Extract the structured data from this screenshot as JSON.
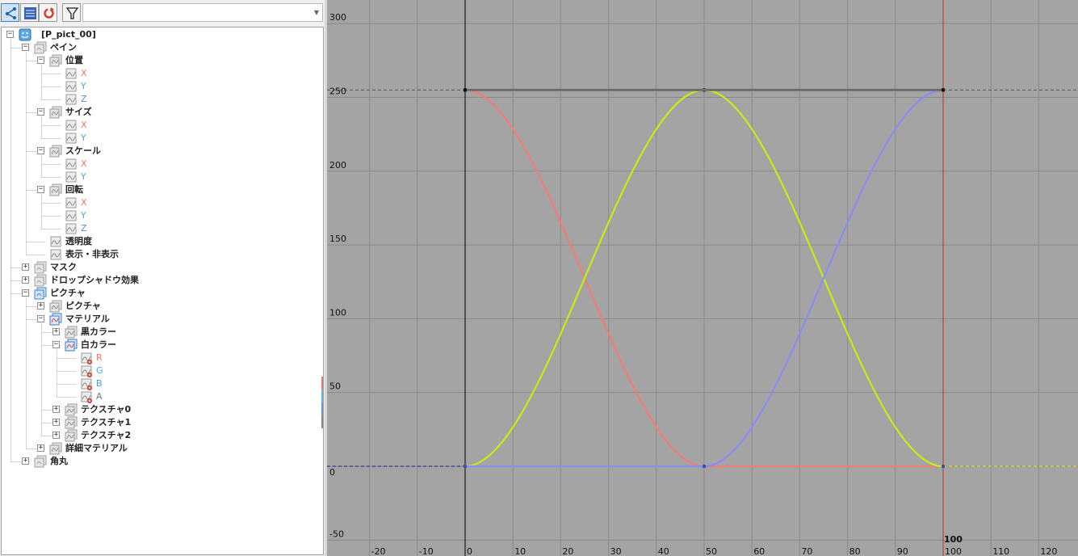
{
  "toolbar": {
    "buttons": [
      {
        "name": "tree-view-button",
        "icon": "tree-icon",
        "active": true
      },
      {
        "name": "list-view-button",
        "icon": "list-icon",
        "active": false
      },
      {
        "name": "refresh-button",
        "icon": "refresh-icon",
        "active": false
      },
      {
        "name": "filter-button",
        "icon": "filter-icon",
        "active": false
      }
    ],
    "filter_value": ""
  },
  "tree": [
    {
      "label": "[P_pict_00]",
      "depth": 0,
      "expander": "-",
      "icon": "layer-face-icon",
      "name": "tree-node-root"
    },
    {
      "label": "ペイン",
      "depth": 1,
      "expander": "-",
      "icon": "group-icon",
      "name": "tree-node-pane"
    },
    {
      "label": "位置",
      "depth": 2,
      "expander": "-",
      "icon": "curve-group-icon",
      "name": "tree-node-position"
    },
    {
      "label": "X",
      "depth": 3,
      "icon": "curve-icon",
      "style": "axis-x",
      "name": "tree-node-position-x"
    },
    {
      "label": "Y",
      "depth": 3,
      "icon": "curve-icon",
      "style": "axis-y",
      "name": "tree-node-position-y"
    },
    {
      "label": "Z",
      "depth": 3,
      "icon": "curve-icon",
      "style": "axis-z",
      "name": "tree-node-position-z"
    },
    {
      "label": "サイズ",
      "depth": 2,
      "expander": "-",
      "icon": "curve-group-icon",
      "name": "tree-node-size"
    },
    {
      "label": "X",
      "depth": 3,
      "icon": "curve-icon",
      "style": "axis-x",
      "name": "tree-node-size-x"
    },
    {
      "label": "Y",
      "depth": 3,
      "icon": "curve-icon",
      "style": "axis-y",
      "name": "tree-node-size-y"
    },
    {
      "label": "スケール",
      "depth": 2,
      "expander": "-",
      "icon": "curve-group-icon",
      "name": "tree-node-scale"
    },
    {
      "label": "X",
      "depth": 3,
      "icon": "curve-icon",
      "style": "axis-x",
      "name": "tree-node-scale-x"
    },
    {
      "label": "Y",
      "depth": 3,
      "icon": "curve-icon",
      "style": "axis-y",
      "name": "tree-node-scale-y"
    },
    {
      "label": "回転",
      "depth": 2,
      "expander": "-",
      "icon": "curve-group-icon",
      "name": "tree-node-rotation"
    },
    {
      "label": "X",
      "depth": 3,
      "icon": "curve-icon",
      "style": "axis-x",
      "name": "tree-node-rotation-x"
    },
    {
      "label": "Y",
      "depth": 3,
      "icon": "curve-icon",
      "style": "axis-y",
      "name": "tree-node-rotation-y"
    },
    {
      "label": "Z",
      "depth": 3,
      "icon": "curve-icon",
      "style": "axis-z",
      "name": "tree-node-rotation-z"
    },
    {
      "label": "透明度",
      "depth": 2,
      "icon": "curve-icon",
      "name": "tree-node-opacity"
    },
    {
      "label": "表示・非表示",
      "depth": 2,
      "icon": "curve-icon",
      "name": "tree-node-visibility"
    },
    {
      "label": "マスク",
      "depth": 1,
      "expander": "+",
      "icon": "group-icon",
      "name": "tree-node-mask"
    },
    {
      "label": "ドロップシャドウ効果",
      "depth": 1,
      "expander": "+",
      "icon": "group-icon",
      "name": "tree-node-drop-shadow"
    },
    {
      "label": "ピクチャ",
      "depth": 1,
      "expander": "-",
      "icon": "picture-group-icon",
      "name": "tree-node-picture"
    },
    {
      "label": "ピクチャ",
      "depth": 2,
      "expander": "+",
      "icon": "curve-group-icon",
      "name": "tree-node-picture-sub"
    },
    {
      "label": "マテリアル",
      "depth": 2,
      "expander": "-",
      "icon": "curve-group-blue-icon",
      "name": "tree-node-material"
    },
    {
      "label": "黒カラー",
      "depth": 3,
      "expander": "+",
      "icon": "curve-group-icon",
      "name": "tree-node-black-color"
    },
    {
      "label": "白カラー",
      "depth": 3,
      "expander": "-",
      "icon": "curve-group-blue-icon",
      "name": "tree-node-white-color"
    },
    {
      "label": "R",
      "depth": 4,
      "icon": "curve-key-icon",
      "style": "ch-r",
      "name": "tree-node-white-r"
    },
    {
      "label": "G",
      "depth": 4,
      "icon": "curve-key-icon",
      "style": "ch-g",
      "name": "tree-node-white-g"
    },
    {
      "label": "B",
      "depth": 4,
      "icon": "curve-key-icon",
      "style": "ch-b",
      "name": "tree-node-white-b"
    },
    {
      "label": "A",
      "depth": 4,
      "icon": "curve-key-icon",
      "style": "ch-a",
      "name": "tree-node-white-a"
    },
    {
      "label": "テクスチャ0",
      "depth": 3,
      "expander": "+",
      "icon": "curve-group-icon",
      "name": "tree-node-texture0"
    },
    {
      "label": "テクスチャ1",
      "depth": 3,
      "expander": "+",
      "icon": "curve-group-icon",
      "name": "tree-node-texture1"
    },
    {
      "label": "テクスチャ2",
      "depth": 3,
      "expander": "+",
      "icon": "curve-group-icon",
      "name": "tree-node-texture2"
    },
    {
      "label": "詳細マテリアル",
      "depth": 2,
      "expander": "+",
      "icon": "curve-group-icon",
      "name": "tree-node-detail-material"
    },
    {
      "label": "角丸",
      "depth": 1,
      "expander": "+",
      "icon": "group-icon",
      "name": "tree-node-rounded-corner"
    }
  ],
  "graph": {
    "x_ticks": [
      -20,
      -10,
      0,
      10,
      20,
      30,
      40,
      50,
      60,
      70,
      80,
      90,
      100,
      110,
      120
    ],
    "y_ticks": [
      -50,
      0,
      50,
      100,
      150,
      200,
      250,
      300
    ],
    "current_frame": 100,
    "current_frame_label": "100",
    "max_value_line": 255,
    "background": "#a4a4a4",
    "grid_color": "#8a8a8a",
    "frame_line_color": "#cc2a2a"
  },
  "chart_data": {
    "type": "line",
    "x_range": [
      -25,
      127
    ],
    "y_range": [
      -55,
      310
    ],
    "series": [
      {
        "name": "R",
        "color": "#f07d76",
        "keys": [
          [
            0,
            255
          ],
          [
            50,
            0
          ],
          [
            100,
            0
          ]
        ]
      },
      {
        "name": "G",
        "color": "#c6ee10",
        "keys": [
          [
            0,
            0
          ],
          [
            50,
            255
          ],
          [
            100,
            0
          ]
        ]
      },
      {
        "name": "B",
        "color": "#8a8cf5",
        "keys": [
          [
            0,
            0
          ],
          [
            50,
            0
          ],
          [
            100,
            255
          ]
        ]
      },
      {
        "name": "A",
        "color": "#6e6e6e",
        "keys": [
          [
            0,
            255
          ],
          [
            100,
            255
          ]
        ]
      }
    ]
  }
}
